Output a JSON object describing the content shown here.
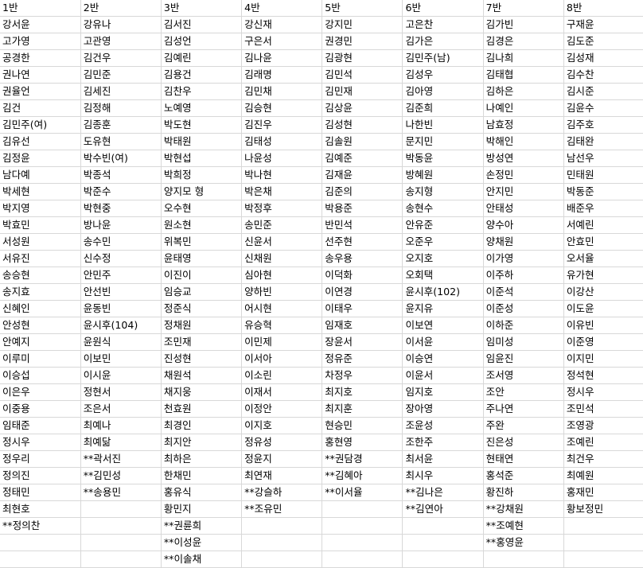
{
  "headers": [
    "1반",
    "2반",
    "3반",
    "4반",
    "5반",
    "6반",
    "7반",
    "8반"
  ],
  "rows": [
    [
      "강서윤",
      "강유나",
      "김서진",
      "강신재",
      "강지민",
      "고은찬",
      "김가빈",
      "구재윤"
    ],
    [
      "고가영",
      "고관영",
      "김성언",
      "구은서",
      "권경민",
      "김가은",
      "김경은",
      "김도준"
    ],
    [
      "공경한",
      "김건우",
      "김예린",
      "김나윤",
      "김광현",
      "김민주(남)",
      "김나희",
      "김성재"
    ],
    [
      "권나연",
      "김민준",
      "김용건",
      "김래명",
      "김민석",
      "김성우",
      "김태협",
      "김수찬"
    ],
    [
      "권율언",
      "김세진",
      "김찬우",
      "김민채",
      "김민재",
      "김아영",
      "김하은",
      "김시준"
    ],
    [
      "김건",
      "김정해",
      "노예영",
      "김승현",
      "김상윤",
      "김준희",
      "나예인",
      "김윤수"
    ],
    [
      "김민주(여)",
      "김종훈",
      "박도현",
      "김진우",
      "김성현",
      "나한빈",
      "남효정",
      "김주호"
    ],
    [
      "김유선",
      "도유현",
      "박태원",
      "김태성",
      "김솔원",
      "문지민",
      "박해인",
      "김태완"
    ],
    [
      "김정윤",
      "박수빈(여)",
      "박현섭",
      "나윤성",
      "김예준",
      "박동윤",
      "방성연",
      "남선우"
    ],
    [
      "남다예",
      "박종석",
      "박희정",
      "박나현",
      "김재윤",
      "방혜원",
      "손정민",
      "민태원"
    ],
    [
      "박세현",
      "박준수",
      "양지모 형",
      "박은채",
      "김준의",
      "송지형",
      "안지민",
      "박동준"
    ],
    [
      "박지영",
      "박현중",
      "오수현",
      "박정후",
      "박용준",
      "송현수",
      "안태성",
      "배준우"
    ],
    [
      "박효민",
      "방나윤",
      "원소현",
      "송민준",
      "반민석",
      "안유준",
      "양수아",
      "서예린"
    ],
    [
      "서성원",
      "송수민",
      "위복민",
      "신윤서",
      "선주현",
      "오준우",
      "양채원",
      "안효민"
    ],
    [
      "서유진",
      "신수정",
      "윤태영",
      "신채원",
      "송우용",
      "오지호",
      "이가영",
      "오서율"
    ],
    [
      "송승현",
      "안민주",
      "이진이",
      "심아현",
      "이덕화",
      "오회택",
      "이주하",
      "유가현"
    ],
    [
      "송지효",
      "안선빈",
      "임승교",
      "양하빈",
      "이연경",
      "윤시후(102)",
      "이준석",
      "이강산"
    ],
    [
      "신혜인",
      "윤동빈",
      "정준식",
      "어시현",
      "이태우",
      "윤지유",
      "이준성",
      "이도윤"
    ],
    [
      "안성현",
      "윤시후(104)",
      "정채원",
      "유승혁",
      "임재호",
      "이보연",
      "이하준",
      "이유빈"
    ],
    [
      "안예지",
      "윤원식",
      "조민재",
      "이민제",
      "장윤서",
      "이서윤",
      "임미성",
      "이준영"
    ],
    [
      "이루미",
      "이보민",
      "진성현",
      "이서아",
      "정유준",
      "이승연",
      "임윤진",
      "이지민"
    ],
    [
      "이승섭",
      "이시윤",
      "채원석",
      "이소린",
      "차정우",
      "이윤서",
      "조서영",
      "정석현"
    ],
    [
      "이은우",
      "정현서",
      "채지웅",
      "이재서",
      "최지호",
      "임지호",
      "조안",
      "정시우"
    ],
    [
      "이중용",
      "조은서",
      "천효원",
      "이정안",
      "최지훈",
      "장아영",
      "주나연",
      "조민석"
    ],
    [
      "임태준",
      "최예나",
      "최경인",
      "이지호",
      "현승민",
      "조윤성",
      "주완",
      "조영광"
    ],
    [
      "정시우",
      "최예닮",
      "최지안",
      "정유성",
      "홍현영",
      "조한주",
      "진은성",
      "조예린"
    ],
    [
      "정우리",
      "**곽서진",
      "최하은",
      "정윤지",
      "**권담경",
      "최서윤",
      "현태연",
      "최건우"
    ],
    [
      "정의진",
      "**김민성",
      "한채민",
      "최연재",
      "**김혜아",
      "최시우",
      "홍석준",
      "최예원"
    ],
    [
      "정태민",
      "**송용민",
      "홍유식",
      "**강슬하",
      "**이서율",
      "**김나은",
      "황진하",
      "홍재민"
    ],
    [
      "최현호",
      "",
      "황민지",
      "**조유민",
      "",
      "**김연아",
      "**강채원",
      "황보정민"
    ],
    [
      "**정의찬",
      "",
      "**권륜희",
      "",
      "",
      "",
      "**조예현",
      ""
    ],
    [
      "",
      "",
      "**이성윤",
      "",
      "",
      "",
      "**홍영윤",
      ""
    ],
    [
      "",
      "",
      "**이솔채",
      "",
      "",
      "",
      "",
      ""
    ]
  ]
}
